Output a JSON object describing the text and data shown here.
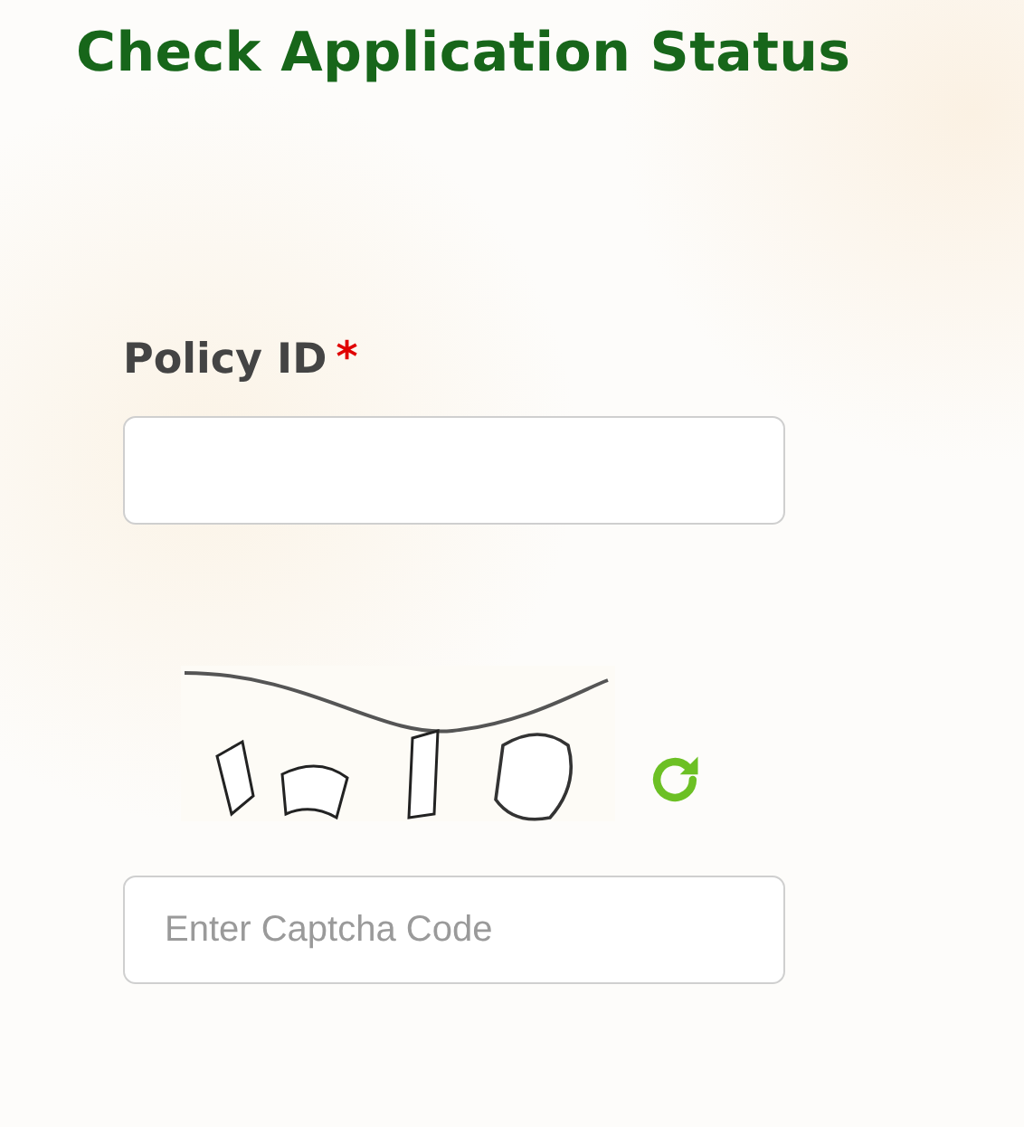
{
  "title": "Check Application Status",
  "policy_field": {
    "label": "Policy ID",
    "required_mark": "*"
  },
  "captcha_field": {
    "placeholder": "Enter Captcha Code"
  }
}
